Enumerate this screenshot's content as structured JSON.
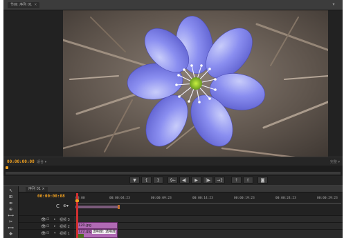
{
  "window": {
    "monitor_tab": "节目: 序列 01",
    "monitor_tab_close": "×",
    "panel_menu": "▾"
  },
  "monitor": {
    "current_time": "00:00:00:08",
    "fit_label": "适合 ▾",
    "duration": "完整 ▾"
  },
  "transport": {
    "buttons": [
      {
        "name": "add-marker-button",
        "glyph": "▼"
      },
      {
        "name": "mark-in-button",
        "glyph": "{"
      },
      {
        "name": "mark-out-button",
        "glyph": "}"
      },
      {
        "name": "go-to-in-button",
        "glyph": "{←"
      },
      {
        "name": "step-back-button",
        "glyph": "◀|"
      },
      {
        "name": "play-button",
        "glyph": "▶"
      },
      {
        "name": "step-forward-button",
        "glyph": "|▶"
      },
      {
        "name": "go-to-out-button",
        "glyph": "→}"
      },
      {
        "name": "lift-button",
        "glyph": "⇡"
      },
      {
        "name": "extract-button",
        "glyph": "⇧"
      },
      {
        "name": "export-frame-button",
        "glyph": "◙"
      }
    ]
  },
  "timeline": {
    "sequence_tab": "序列 01 ×",
    "current_time": "00:00:00:08",
    "ruler_ticks": [
      "00:00",
      "00:00:04:23",
      "00:00:09:23",
      "00:00:14:23",
      "00:00:19:23",
      "00:00:24:23",
      "00:00:29:23"
    ],
    "tracks": [
      {
        "eye": "👁",
        "lock": "⊟",
        "tri": "▸",
        "label": "视频 3"
      },
      {
        "eye": "👁",
        "lock": "⊟",
        "tri": "▸",
        "label": "视频 2"
      },
      {
        "eye": "👁",
        "lock": "⊟",
        "tri": "▾",
        "label": "视频 1"
      }
    ],
    "clip_v2": "120.jpg",
    "clip_v1": "122.jpg",
    "clip_v1_fx": "透明度: 透明度 ▾",
    "tools": [
      "↖",
      "⊞",
      "⇹",
      "⊕",
      "⟷",
      "✂",
      "⟺",
      "✥"
    ],
    "snap_glyph": "C",
    "marker_glyph": "⊕▾"
  }
}
